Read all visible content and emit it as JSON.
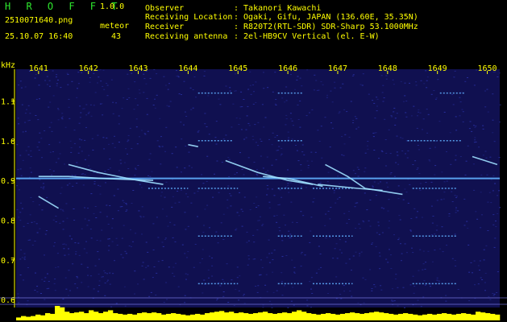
{
  "header": {
    "app_name": "H R O F F T",
    "app_version": "1.0.0",
    "filename": "2510071640.png",
    "mode_label": "meteor",
    "datetime": "25.10.07 16:40",
    "meteor_count": "43",
    "fields": [
      {
        "label": "Observer",
        "value": ": Takanori Kawachi"
      },
      {
        "label": "Receiving Location",
        "value": ": Ogaki, Gifu, JAPAN (136.60E, 35.35N)"
      },
      {
        "label": "Receiver",
        "value": ": R820T2(RTL-SDR) SDR-Sharp 53.1000MHz"
      },
      {
        "label": "Receiving antenna",
        "value": ": 2el-HB9CV Vertical (el. E-W)"
      }
    ]
  },
  "chart_data": {
    "type": "heatmap",
    "ylabel": "kHz",
    "x_ticks": [
      "1641",
      "1642",
      "1643",
      "1644",
      "1645",
      "1646",
      "1647",
      "1648",
      "1649",
      "1650"
    ],
    "y_ticks": [
      "1.1",
      "1.0",
      "0.9",
      "0.8",
      "0.7",
      "0.6"
    ],
    "ylim": [
      0.58,
      1.18
    ],
    "xlim": [
      1640.55,
      1650.25
    ],
    "colors": {
      "background": "#101050",
      "noise": "#2830a0",
      "signal": "#60b0ff",
      "grid": "#ffff00",
      "bar": "#ffff00"
    },
    "carrier_freq_khz": 0.905,
    "dashed_lines": [
      {
        "freq": 1.12,
        "segments": [
          [
            1644.2,
            1644.9
          ],
          [
            1645.8,
            1646.3
          ],
          [
            1649.05,
            1649.55
          ]
        ]
      },
      {
        "freq": 1.0,
        "segments": [
          [
            1644.2,
            1644.9
          ],
          [
            1645.8,
            1646.3
          ],
          [
            1648.4,
            1649.0
          ],
          [
            1649.05,
            1649.5
          ]
        ]
      },
      {
        "freq": 0.88,
        "segments": [
          [
            1643.2,
            1644.0
          ],
          [
            1644.2,
            1645.0
          ],
          [
            1645.8,
            1646.3
          ],
          [
            1646.5,
            1647.3
          ],
          [
            1648.5,
            1649.4
          ]
        ]
      },
      {
        "freq": 0.76,
        "segments": [
          [
            1644.2,
            1644.9
          ],
          [
            1645.8,
            1646.3
          ],
          [
            1646.5,
            1647.3
          ],
          [
            1648.5,
            1649.4
          ]
        ]
      },
      {
        "freq": 0.64,
        "segments": [
          [
            1644.2,
            1645.0
          ],
          [
            1645.8,
            1646.3
          ],
          [
            1646.5,
            1647.3
          ],
          [
            1648.5,
            1649.4
          ]
        ]
      }
    ],
    "meteor_trails": [
      {
        "points": [
          [
            1641.0,
            0.91
          ],
          [
            1641.6,
            0.91
          ],
          [
            1642.3,
            0.905
          ],
          [
            1643.3,
            0.9
          ]
        ]
      },
      {
        "points": [
          [
            1641.6,
            0.94
          ],
          [
            1642.2,
            0.92
          ],
          [
            1643.0,
            0.9
          ],
          [
            1643.5,
            0.89
          ]
        ]
      },
      {
        "points": [
          [
            1641.0,
            0.86
          ],
          [
            1641.4,
            0.83
          ]
        ]
      },
      {
        "points": [
          [
            1644.75,
            0.95
          ],
          [
            1645.4,
            0.92
          ],
          [
            1646.0,
            0.9
          ],
          [
            1646.5,
            0.89
          ]
        ]
      },
      {
        "points": [
          [
            1645.5,
            0.91
          ],
          [
            1646.0,
            0.905
          ],
          [
            1646.7,
            0.885
          ]
        ]
      },
      {
        "points": [
          [
            1646.75,
            0.94
          ],
          [
            1647.2,
            0.91
          ],
          [
            1647.55,
            0.88
          ],
          [
            1648.3,
            0.865
          ]
        ]
      },
      {
        "points": [
          [
            1646.6,
            0.89
          ],
          [
            1647.4,
            0.88
          ],
          [
            1647.9,
            0.875
          ]
        ]
      },
      {
        "points": [
          [
            1649.7,
            0.96
          ],
          [
            1650.2,
            0.94
          ]
        ]
      },
      {
        "points": [
          [
            1644.0,
            0.99
          ],
          [
            1644.2,
            0.985
          ]
        ]
      }
    ],
    "activity_bar": [
      0.2,
      0.3,
      0.25,
      0.3,
      0.4,
      0.35,
      0.5,
      0.45,
      1.0,
      0.9,
      0.6,
      0.5,
      0.55,
      0.6,
      0.5,
      0.7,
      0.6,
      0.5,
      0.6,
      0.7,
      0.5,
      0.45,
      0.4,
      0.45,
      0.4,
      0.5,
      0.55,
      0.5,
      0.55,
      0.5,
      0.4,
      0.45,
      0.5,
      0.45,
      0.4,
      0.35,
      0.4,
      0.45,
      0.4,
      0.5,
      0.55,
      0.6,
      0.65,
      0.55,
      0.6,
      0.5,
      0.55,
      0.5,
      0.45,
      0.5,
      0.55,
      0.6,
      0.5,
      0.45,
      0.5,
      0.55,
      0.5,
      0.6,
      0.7,
      0.6,
      0.5,
      0.45,
      0.4,
      0.45,
      0.5,
      0.45,
      0.4,
      0.45,
      0.5,
      0.55,
      0.5,
      0.45,
      0.5,
      0.55,
      0.6,
      0.55,
      0.5,
      0.45,
      0.4,
      0.45,
      0.5,
      0.45,
      0.4,
      0.35,
      0.4,
      0.45,
      0.4,
      0.45,
      0.5,
      0.45,
      0.4,
      0.45,
      0.5,
      0.45,
      0.4,
      0.6,
      0.55,
      0.5,
      0.45,
      0.4
    ]
  }
}
